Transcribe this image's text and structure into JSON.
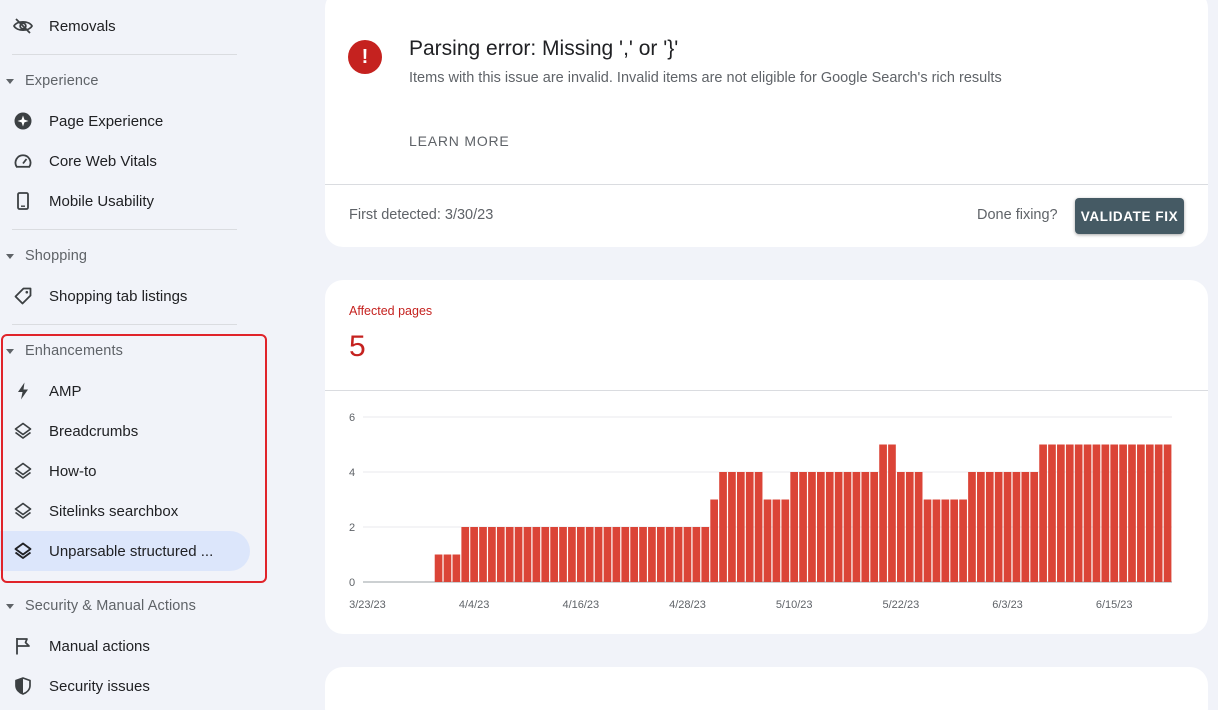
{
  "sidebar": {
    "removals": "Removals",
    "sections": {
      "experience": "Experience",
      "shopping": "Shopping",
      "enhancements": "Enhancements",
      "security": "Security & Manual Actions"
    },
    "items": {
      "page_experience": "Page Experience",
      "core_web_vitals": "Core Web Vitals",
      "mobile_usability": "Mobile Usability",
      "shopping_tab": "Shopping tab listings",
      "amp": "AMP",
      "breadcrumbs": "Breadcrumbs",
      "howto": "How-to",
      "sitelinks": "Sitelinks searchbox",
      "unparsable": "Unparsable structured ...",
      "manual_actions": "Manual actions",
      "security_issues": "Security issues"
    },
    "icons": {
      "removals": "eye-off-icon",
      "page_experience": "page-experience-icon",
      "core_web_vitals": "gauge-icon",
      "mobile_usability": "phone-icon",
      "shopping_tab": "tag-icon",
      "amp": "lightning-icon",
      "layers": "layers-icon",
      "manual_actions": "flag-icon",
      "security_issues": "shield-icon"
    },
    "active": "unparsable"
  },
  "issue": {
    "icon_glyph": "!",
    "title": "Parsing error: Missing ',' or '}'",
    "description": "Items with this issue are invalid. Invalid items are not eligible for Google Search's rich results",
    "learn_more": "LEARN MORE",
    "first_detected": "First detected: 3/30/23",
    "done_fixing": "Done fixing?",
    "validate_button": "VALIDATE FIX"
  },
  "affected": {
    "label": "Affected pages",
    "value": "5"
  },
  "colors": {
    "accent": "#c5221f",
    "bar": "#db4437",
    "button": "#455a64",
    "active_nav": "#dce6fb",
    "highlight_border": "#e0232a"
  },
  "chart_data": {
    "type": "bar",
    "title": "",
    "xlabel": "",
    "ylabel": "",
    "ylim": [
      0,
      6
    ],
    "yticks": [
      0,
      2,
      4,
      6
    ],
    "grid": true,
    "xtick_labels": [
      "3/23/23",
      "4/4/23",
      "4/16/23",
      "4/28/23",
      "5/10/23",
      "5/22/23",
      "6/3/23",
      "6/15/23"
    ],
    "start_date": "2023-03-23",
    "values": [
      0,
      0,
      0,
      0,
      0,
      0,
      0,
      0,
      1,
      1,
      1,
      2,
      2,
      2,
      2,
      2,
      2,
      2,
      2,
      2,
      2,
      2,
      2,
      2,
      2,
      2,
      2,
      2,
      2,
      2,
      2,
      2,
      2,
      2,
      2,
      2,
      2,
      2,
      2,
      3,
      4,
      4,
      4,
      4,
      4,
      3,
      3,
      3,
      4,
      4,
      4,
      4,
      4,
      4,
      4,
      4,
      4,
      4,
      5,
      5,
      4,
      4,
      4,
      3,
      3,
      3,
      3,
      3,
      4,
      4,
      4,
      4,
      4,
      4,
      4,
      4,
      5,
      5,
      5,
      5,
      5,
      5,
      5,
      5,
      5,
      5,
      5,
      5,
      5,
      5,
      5
    ]
  }
}
